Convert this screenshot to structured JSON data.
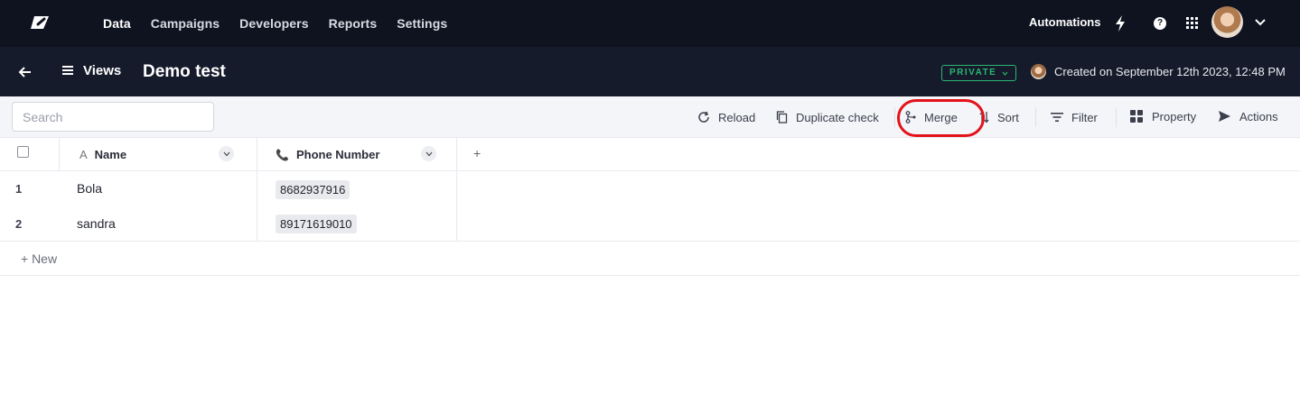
{
  "nav": {
    "links": [
      "Data",
      "Campaigns",
      "Developers",
      "Reports",
      "Settings"
    ],
    "active": "Data",
    "automations_label": "Automations",
    "help_label": "?"
  },
  "header": {
    "views_label": "Views",
    "title": "Demo test",
    "private_label": "PRIVATE",
    "created_text": "Created on September 12th 2023, 12:48 PM"
  },
  "toolbar": {
    "search_placeholder": "Search",
    "reload_label": "Reload",
    "duplicate_label": "Duplicate check",
    "merge_label": "Merge",
    "sort_label": "Sort",
    "filter_label": "Filter",
    "property_label": "Property",
    "actions_label": "Actions"
  },
  "table": {
    "columns": [
      {
        "icon": "text-type-icon",
        "icon_glyph": "A",
        "label": "Name"
      },
      {
        "icon": "phone-icon",
        "icon_glyph": "📞",
        "label": "Phone Number"
      }
    ],
    "add_column_label": "+",
    "rows": [
      {
        "num": "1",
        "name": "Bola",
        "phone": "8682937916"
      },
      {
        "num": "2",
        "name": "sandra",
        "phone": "89171619010"
      }
    ],
    "new_row_label": "+ New"
  },
  "colors": {
    "nav_bg": "#0f1320",
    "header_bg": "#161b2b",
    "private_green": "#2bb673",
    "highlight_red": "#e3121a"
  }
}
